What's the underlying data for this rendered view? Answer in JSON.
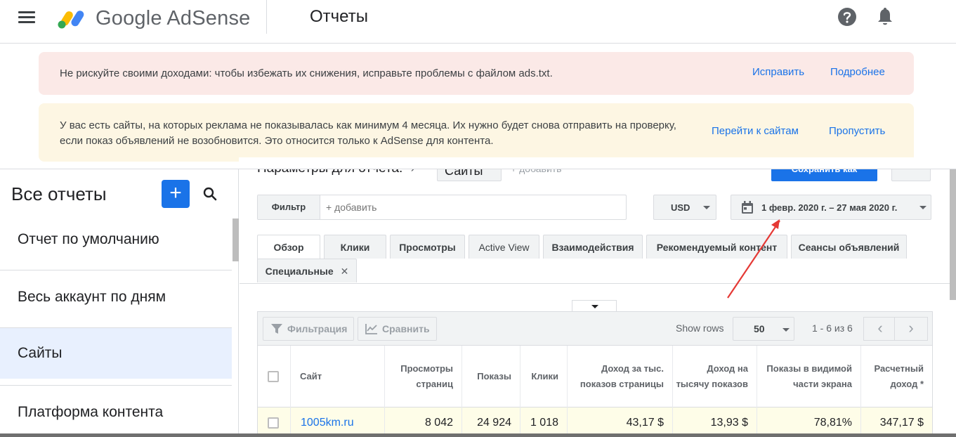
{
  "header": {
    "brand": "Google AdSense",
    "page_title": "Отчеты"
  },
  "alerts": [
    {
      "text": "Не рискуйте своими доходами: чтобы избежать их снижения, исправьте проблемы с файлом ads.txt.",
      "actions": [
        "Исправить",
        "Подробнее"
      ]
    },
    {
      "text": "У вас есть сайты, на которых реклама не показывалась как минимум 4 месяца. Их нужно будет снова отправить на проверку, если показ объявлений не возобновится. Это относится только к AdSense для контента.",
      "actions": [
        "Перейти к сайтам",
        "Пропустить"
      ]
    }
  ],
  "sidebar": {
    "title": "Все отчеты",
    "add_label": "+",
    "items": [
      {
        "label": "Отчет по умолчанию"
      },
      {
        "label": "Весь аккаунт по дням"
      },
      {
        "label": "Сайты"
      },
      {
        "label": "Платформа контента"
      }
    ]
  },
  "report": {
    "params_label": "Параметры для отчета:",
    "params_arrow": "›",
    "dimension_chip": "Сайты",
    "add_link": "+ добавить",
    "save_label": "Сохранить как",
    "filter_label": "Фильтр",
    "filter_placeholder": "+ добавить",
    "currency": "USD",
    "date_range": "1 февр. 2020 г. – 27 мая 2020 г."
  },
  "tabs": [
    {
      "label": "Обзор"
    },
    {
      "label": "Клики"
    },
    {
      "label": "Просмотры"
    },
    {
      "label": "Active View"
    },
    {
      "label": "Взаимодействия"
    },
    {
      "label": "Рекомендуемый контент"
    },
    {
      "label": "Сеансы объявлений"
    },
    {
      "label": "Специальные",
      "close": "✕"
    }
  ],
  "table_toolbar": {
    "filter_label": "Фильтрация",
    "compare_label": "Сравнить",
    "show_rows_label": "Show rows",
    "rows_value": "50",
    "pager_text": "1 - 6 из 6",
    "prev": "‹",
    "next": "›"
  },
  "table": {
    "columns": [
      "Сайт",
      "Просмотры страниц",
      "Показы",
      "Клики",
      "Доход за тыс. показов страницы",
      "Доход на тысячу показов",
      "Показы в видимой части экрана",
      "Расчетный доход *"
    ],
    "rows": [
      [
        "1005km.ru",
        "8 042",
        "24 924",
        "1 018",
        "43,17 $",
        "13,93 $",
        "78,81%",
        "347,17 $"
      ]
    ]
  },
  "colors": {
    "accent": "#1a73e8",
    "alert_red_bg": "#fbe9e7",
    "alert_yellow_bg": "#fdf6e3",
    "selected_row_bg": "#fefde8",
    "annotation_arrow": "#e53935"
  }
}
